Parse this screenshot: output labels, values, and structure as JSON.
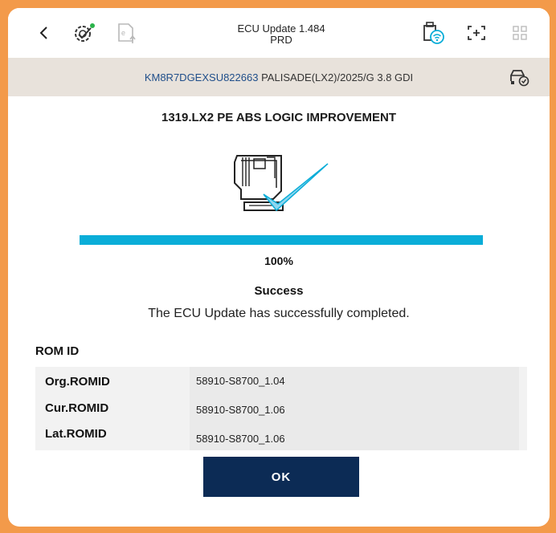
{
  "header": {
    "title_line1": "ECU Update 1.484",
    "title_line2": "PRD"
  },
  "vehicle": {
    "vin": "KM8R7DGEXSU822663",
    "model": "PALISADE(LX2)/2025/G 3.8 GDI"
  },
  "procedure": {
    "title": "1319.LX2 PE ABS LOGIC IMPROVEMENT"
  },
  "progress": {
    "percent_value": 100,
    "percent_label": "100%"
  },
  "result": {
    "status": "Success",
    "message": "The ECU Update has successfully completed."
  },
  "rom": {
    "label": "ROM ID",
    "rows": [
      {
        "key": "Org.ROMID",
        "value": "58910-S8700_1.04"
      },
      {
        "key": "Cur.ROMID",
        "value": "58910-S8700_1.06"
      },
      {
        "key": "Lat.ROMID",
        "value": "58910-S8700_1.06"
      }
    ]
  },
  "actions": {
    "ok_label": "OK"
  },
  "colors": {
    "accent": "#0AADD8",
    "button": "#0C2B55",
    "vin": "#1F4E8A",
    "frame": "#F39A4A"
  },
  "icons": [
    "back-arrow-icon",
    "diagnostic-icon",
    "ecu-document-icon",
    "usb-wifi-icon",
    "screen-capture-icon",
    "grid-icon",
    "vehicle-check-icon"
  ]
}
